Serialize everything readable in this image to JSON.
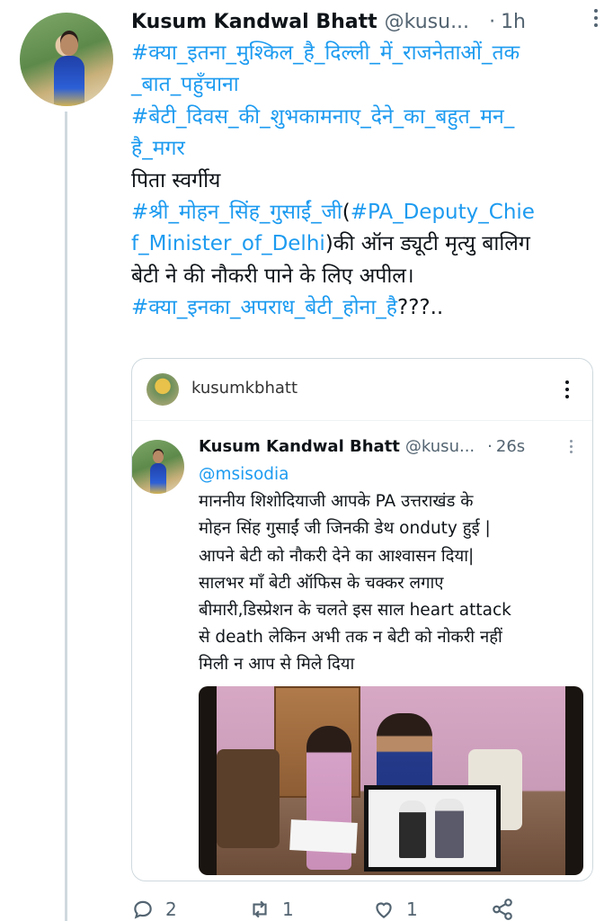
{
  "tweet": {
    "author_name": "Kusum Kandwal Bhatt",
    "author_handle": "@kusu...",
    "separator": "·",
    "time": "1h",
    "lines": [
      {
        "parts": [
          {
            "text": "#क्या_इतना_मुश्किल_है_दिल्ली_में_राजनेताओं_तक",
            "tag": true
          }
        ]
      },
      {
        "parts": [
          {
            "text": "_बात_पहुँचाना",
            "tag": true
          }
        ]
      },
      {
        "parts": [
          {
            "text": "#बेटी_दिवस_की_शुभकामनाए_देने_का_बहुत_मन_",
            "tag": true
          }
        ]
      },
      {
        "parts": [
          {
            "text": "है_मगर",
            "tag": true
          }
        ]
      },
      {
        "parts": [
          {
            "text": "पिता स्वर्गीय",
            "tag": false
          }
        ]
      },
      {
        "parts": [
          {
            "text": "#श्री_मोहन_सिंह_गुसाईं_जी",
            "tag": true
          },
          {
            "text": "(",
            "tag": false
          },
          {
            "text": "#PA_Deputy_Chie",
            "tag": true
          }
        ]
      },
      {
        "parts": [
          {
            "text": "f_Minister_of_Delhi",
            "tag": true
          },
          {
            "text": ")की ऑन ड्यूटी मृत्यु बालिग",
            "tag": false
          }
        ]
      },
      {
        "parts": [
          {
            "text": "बेटी ने की नौकरी पाने के लिए अपील।",
            "tag": false
          }
        ]
      },
      {
        "parts": [
          {
            "text": "#क्या_इनका_अपराध_बेटी_होना_है",
            "tag": true
          },
          {
            "text": "???..",
            "tag": false
          }
        ]
      }
    ]
  },
  "quote": {
    "top_username": "kusumkbhatt",
    "author_name": "Kusum Kandwal Bhatt",
    "author_handle": "@kusu...",
    "separator": "·",
    "time": "26s",
    "lines": [
      {
        "parts": [
          {
            "text": "@msisodia",
            "tag": true
          }
        ]
      },
      {
        "parts": [
          {
            "text": "माननीय शिशोदियाजी आपके PA उत्तराखंड के",
            "tag": false
          }
        ]
      },
      {
        "parts": [
          {
            "text": "मोहन सिंह गुसाईं जी जिनकी डेथ onduty हुई |",
            "tag": false
          }
        ]
      },
      {
        "parts": [
          {
            "text": "आपने बेटी को नौकरी देने का आश्वासन दिया|",
            "tag": false
          }
        ]
      },
      {
        "parts": [
          {
            "text": "सालभर माँ बेटी ऑफिस के चक्कर लगाए",
            "tag": false
          }
        ]
      },
      {
        "parts": [
          {
            "text": "बीमारी,डिस्प्रेशन के चलते इस साल heart attack",
            "tag": false
          }
        ]
      },
      {
        "parts": [
          {
            "text": "से death लेकिन अभी तक न बेटी को नोकरी नहीं",
            "tag": false
          }
        ]
      },
      {
        "parts": [
          {
            "text": "मिली न आप से मिले दिया",
            "tag": false
          }
        ]
      }
    ]
  },
  "actions": {
    "reply_count": "2",
    "retweet_count": "1",
    "like_count": "1"
  },
  "colors": {
    "link": "#1d9bf0",
    "text": "#0f1419",
    "muted": "#536471",
    "border": "#cfd9de"
  }
}
